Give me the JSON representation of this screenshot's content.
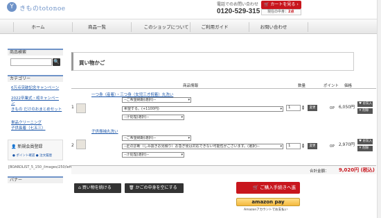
{
  "header": {
    "logo_mark": "Y",
    "logo_text": "きものtotonoe",
    "phone_label": "電話でのお問い合わせ",
    "phone_number": "0120-529-315",
    "cart_button": "カートを見る",
    "cart_count_label": "現在の中身：",
    "cart_count_value": "2点"
  },
  "nav": [
    "ホーム",
    "商品一覧",
    "このショップについて",
    "ご利用ガイド",
    "お問い合わせ"
  ],
  "sidebar": {
    "search_head": "商品検索",
    "search_button": "🔍",
    "category_head": "カテゴリー",
    "categories": [
      "6万点突破記念キャンペーン",
      "2022卒業式・袴キャンペーン",
      "きもの だけのおまとめセット",
      "単品クリーニング",
      "子供長着（七五三）"
    ],
    "member_title": "新規会員登録",
    "member_links": [
      "ポイント確認",
      "注文履歴"
    ],
    "banner_head": "バナー",
    "boardlist": "[BOARDLIST_5_150_/images/250/leftdot.gif]"
  },
  "cart": {
    "title": "買い物かご",
    "headers": {
      "info": "商品情報",
      "qty": "数量",
      "point": "ポイント",
      "price": "価格"
    },
    "change_label": "変更",
    "fav_label": "お気入",
    "delete_label": "削除",
    "rows": [
      {
        "num": "1",
        "name": "一つ身（産着）・三つ身（女児三才祝着）丸洗い",
        "options": [
          "--ご希望納期(選択)--",
          "希望する。(+1100円)",
          "--汗処理(選択)--"
        ],
        "qty": "1",
        "point": "0P",
        "price": "6,050円"
      },
      {
        "num": "2",
        "name": "子供振袖丸洗い",
        "options": [
          "--ご希望納期(選択)--",
          "--匠の診断（しみ抜きお見積り）お急ぎ便は対応できない可能性がございます。(選択)--",
          "--汗処理(選択)--"
        ],
        "qty": "1",
        "point": "0P",
        "price": "2,970円"
      }
    ],
    "total_label": "合計金額：",
    "total_value": "9,020円 (税込)",
    "continue_button": "買い物を続ける",
    "empty_button": "かごの中身を空にする",
    "order_button": "ご購入手続きへ進む",
    "amazon_button": "amazon pay",
    "amazon_note": "Amazonアカウントでお支払い"
  }
}
